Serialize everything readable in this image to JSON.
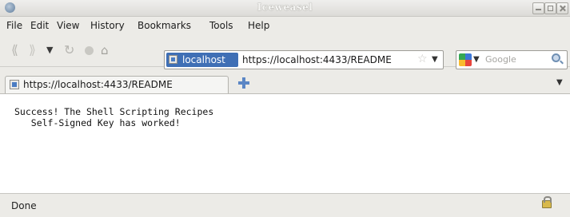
{
  "window": {
    "title": "Iceweasel"
  },
  "menubar": {
    "items": [
      "File",
      "Edit",
      "View",
      "History",
      "Bookmarks",
      "Tools",
      "Help"
    ]
  },
  "navbar": {
    "site_identity": "localhost",
    "url": "https://localhost:4433/README",
    "search_placeholder": "Google",
    "icons": [
      "back-icon",
      "forward-icon",
      "history-dropdown-icon",
      "reload-icon",
      "stop-icon",
      "home-icon",
      "star-icon",
      "search-icon"
    ]
  },
  "tabs": [
    {
      "label": "https://localhost:4433/README"
    }
  ],
  "content": {
    "text": "Success! The Shell Scripting Recipes\n   Self-Signed Key has worked!"
  },
  "status": {
    "text": "Done"
  }
}
